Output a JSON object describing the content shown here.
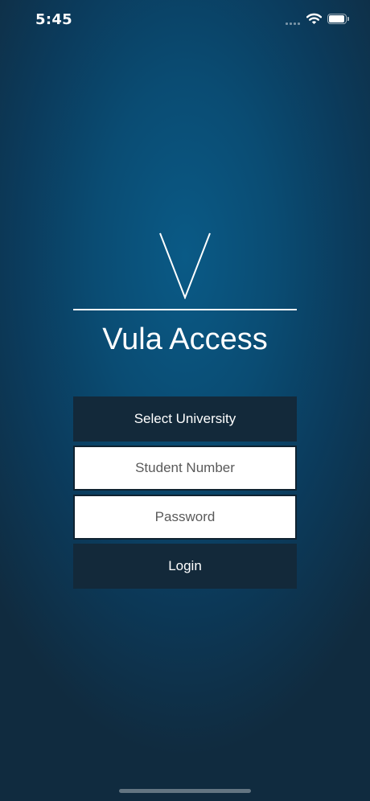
{
  "status_bar": {
    "time": "5:45",
    "signal_icon": "cellular-signal-icon",
    "wifi_icon": "wifi-icon",
    "battery_icon": "battery-icon",
    "battery_level": 1.0
  },
  "logo": {
    "icon": "v-logo-icon",
    "title": "Vula Access"
  },
  "form": {
    "university_select_label": "Select University",
    "student_number_placeholder": "Student Number",
    "student_number_value": "",
    "password_placeholder": "Password",
    "password_value": "",
    "login_label": "Login"
  },
  "colors": {
    "background_center": "#0a5a86",
    "background_edge": "#102b3f",
    "button_dark": "#13293a",
    "text_light": "#ffffff",
    "field_background": "#ffffff"
  }
}
